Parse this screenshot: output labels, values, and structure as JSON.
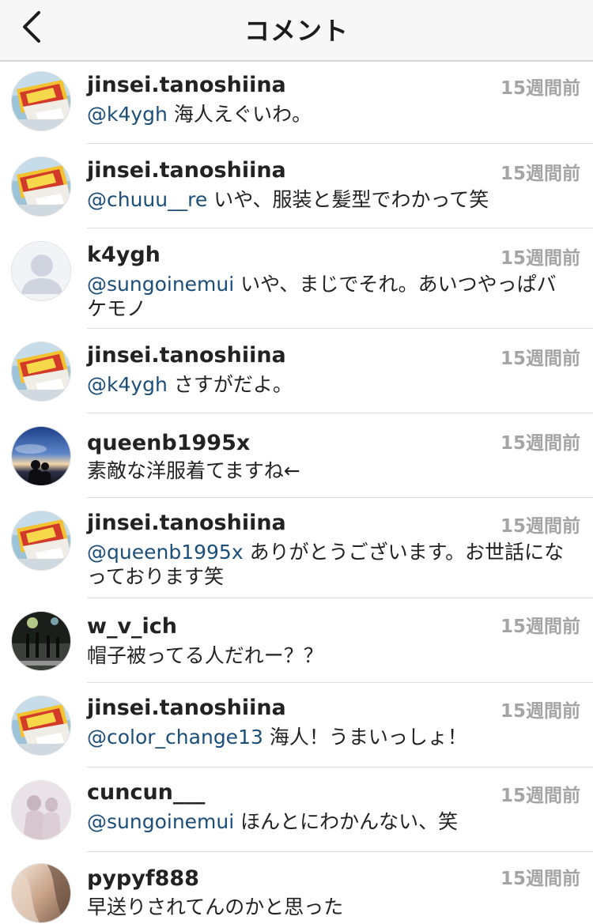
{
  "header": {
    "title": "コメント",
    "back_icon": "chevron-left-icon"
  },
  "comments": [
    {
      "username": "jinsei.tanoshiina",
      "time": "15週間前",
      "mention": "@k4ygh",
      "text": "海人えぐいわ。",
      "avatar": "snack-photo"
    },
    {
      "username": "jinsei.tanoshiina",
      "time": "15週間前",
      "mention": "@chuuu__re",
      "text": "いや、服装と髪型でわかって笑",
      "avatar": "snack-photo"
    },
    {
      "username": "k4ygh",
      "time": "15週間前",
      "mention": "@sungoinemui",
      "text": "いや、まじでそれ。あいつやっぱバケモノ",
      "avatar": "default-user"
    },
    {
      "username": "jinsei.tanoshiina",
      "time": "15週間前",
      "mention": "@k4ygh",
      "text": "さすがだよ。",
      "avatar": "snack-photo"
    },
    {
      "username": "queenb1995x",
      "time": "15週間前",
      "mention": "",
      "text": "素敵な洋服着てますね←",
      "avatar": "sunset-silhouette"
    },
    {
      "username": "jinsei.tanoshiina",
      "time": "15週間前",
      "mention": "@queenb1995x",
      "text": "ありがとうございます。お世話になっております笑",
      "avatar": "snack-photo"
    },
    {
      "username": "w_v_ich",
      "time": "15週間前",
      "mention": "",
      "text": "帽子被ってる人だれー？？",
      "avatar": "night-street"
    },
    {
      "username": "jinsei.tanoshiina",
      "time": "15週間前",
      "mention": "@color_change13",
      "text": "海人！うまいっしょ！",
      "avatar": "snack-photo"
    },
    {
      "username": "cuncun___",
      "time": "15週間前",
      "mention": "@sungoinemui",
      "text": "ほんとにわかんない、笑",
      "avatar": "pastel-figures"
    },
    {
      "username": "pypyf888",
      "time": "15週間前",
      "mention": "",
      "text": "早送りされてんのかと思った",
      "avatar": "hair-closeup"
    }
  ],
  "colors": {
    "mention": "#1b4e79",
    "timestamp": "#a4a4a4",
    "text": "#222222",
    "navbar_bg": "#f7f7f7"
  }
}
